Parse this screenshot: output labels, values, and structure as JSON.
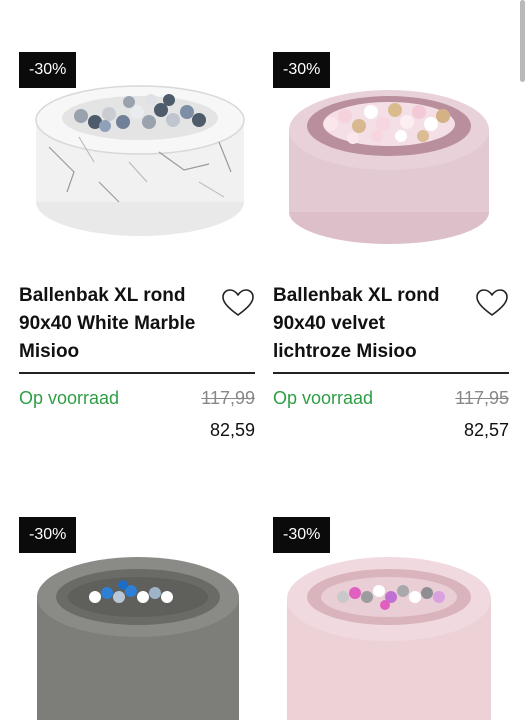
{
  "products": [
    {
      "badge": "-30%",
      "title_line1": "Ballenbak XL rond",
      "title_line2": "90x40 White Marble",
      "title_line3": "Misioo",
      "stock": "Op voorraad",
      "old_price": "117,99",
      "price": "82,59"
    },
    {
      "badge": "-30%",
      "title_line1": "Ballenbak XL rond",
      "title_line2": "90x40 velvet",
      "title_line3": "lichtroze Misioo",
      "stock": "Op voorraad",
      "old_price": "117,95",
      "price": "82,57"
    },
    {
      "badge": "-30%"
    },
    {
      "badge": "-30%"
    }
  ],
  "colors": {
    "stock_green": "#2e9e45",
    "badge_bg": "#0b0b0b"
  },
  "icons": {
    "wishlist": "heart-outline-icon"
  }
}
